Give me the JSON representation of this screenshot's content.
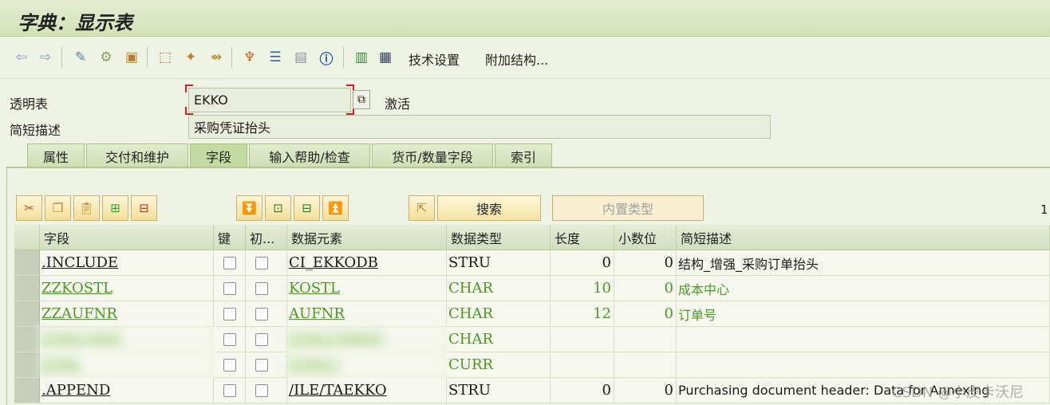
{
  "title": "字典：显示表",
  "toolbar": {
    "technical_settings": "技术设置",
    "append_structure": "附加结构..."
  },
  "form": {
    "table_label": "透明表",
    "table_value": "EKKO",
    "status": "激活",
    "desc_label": "简短描述",
    "desc_value": "采购凭证抬头"
  },
  "tabs": [
    "属性",
    "交付和维护",
    "字段",
    "输入帮助/检查",
    "货币/数量字段",
    "索引"
  ],
  "buttons": {
    "search": "搜索",
    "builtin_type": "内置类型",
    "page_indicator": "1"
  },
  "columns": [
    "字段",
    "键",
    "初...",
    "数据元素",
    "数据类型",
    "长度",
    "小数位",
    "简短描述"
  ],
  "rows": [
    {
      "field": ".INCLUDE",
      "element": "CI_EKKODB",
      "type": "STRU",
      "length": "0",
      "decimals": "0",
      "desc": "结构_增强_采购订单抬头",
      "green": false
    },
    {
      "field": "ZZKOSTL",
      "element": "KOSTL",
      "type": "CHAR",
      "length": "10",
      "decimals": "0",
      "desc": "成本中心",
      "green": true
    },
    {
      "field": "ZZAUFNR",
      "element": "AUFNR",
      "type": "CHAR",
      "length": "12",
      "decimals": "0",
      "desc": "订单号",
      "green": true
    },
    {
      "field": "ZZBLURR1",
      "element": "ZZBLURRED",
      "type": "CHAR",
      "length": "",
      "decimals": "",
      "desc": "",
      "green": true,
      "blurred": true
    },
    {
      "field": "ZZBL",
      "element": "ZZBLU",
      "type": "CURR",
      "length": "",
      "decimals": "",
      "desc": "",
      "green": true,
      "blurred": true
    },
    {
      "field": ".APPEND",
      "element": "/ILE/TAEKKO",
      "type": "STRU",
      "length": "0",
      "decimals": "0",
      "desc": "Purchasing document header: Data for Annexing",
      "green": false
    }
  ],
  "watermark": "CSDN @小皮卡沃尼"
}
